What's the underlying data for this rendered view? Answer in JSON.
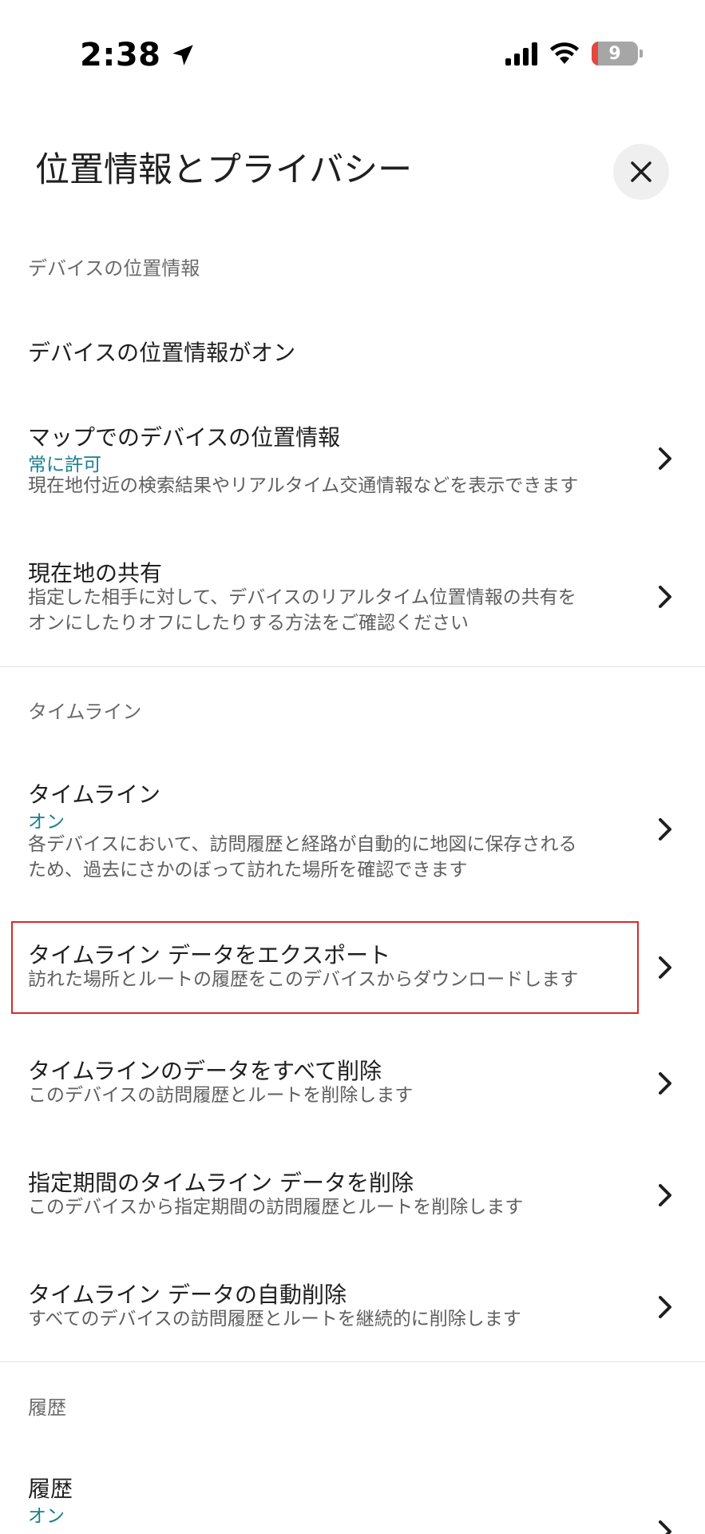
{
  "status_bar": {
    "time": "2:38",
    "battery_level": "9",
    "icons": [
      "location-arrow-icon",
      "cellular-signal-icon",
      "wifi-icon",
      "battery-icon"
    ]
  },
  "header": {
    "title": "位置情報とプライバシー",
    "close_icon": "close-icon"
  },
  "sections": {
    "device": {
      "header": "デバイスの位置情報",
      "items": [
        {
          "title": "デバイスの位置情報がオン"
        },
        {
          "title": "マップでのデバイスの位置情報",
          "status": "常に許可",
          "desc": [
            "現在地付近の検索結果やリアルタイム交通情報などを表示できます"
          ]
        },
        {
          "title": "現在地の共有",
          "desc": [
            "指定した相手に対して、デバイスのリアルタイム位置情報の共有を",
            "オンにしたりオフにしたりする方法をご確認ください"
          ]
        }
      ]
    },
    "timeline": {
      "header": "タイムライン",
      "items": [
        {
          "title": "タイムライン",
          "status": "オン",
          "desc": [
            "各デバイスにおいて、訪問履歴と経路が自動的に地図に保存される",
            "ため、過去にさかのぼって訪れた場所を確認できます"
          ]
        },
        {
          "title": "タイムライン データをエクスポート",
          "desc": [
            "訪れた場所とルートの履歴をこのデバイスからダウンロードします"
          ]
        },
        {
          "title": "タイムラインのデータをすべて削除",
          "desc": [
            "このデバイスの訪問履歴とルートを削除します"
          ]
        },
        {
          "title": "指定期間のタイムライン データを削除",
          "desc": [
            "このデバイスから指定期間の訪問履歴とルートを削除します"
          ]
        },
        {
          "title": "タイムライン データの自動削除",
          "desc": [
            "すべてのデバイスの訪問履歴とルートを継続的に削除します"
          ]
        }
      ]
    },
    "history": {
      "header": "履歴",
      "items": [
        {
          "title": "履歴",
          "status": "オン"
        }
      ]
    }
  },
  "colors": {
    "accent_status": "#1a7f8e",
    "highlight_border": "#d62b2b",
    "secondary_text": "#5f5f5f"
  }
}
